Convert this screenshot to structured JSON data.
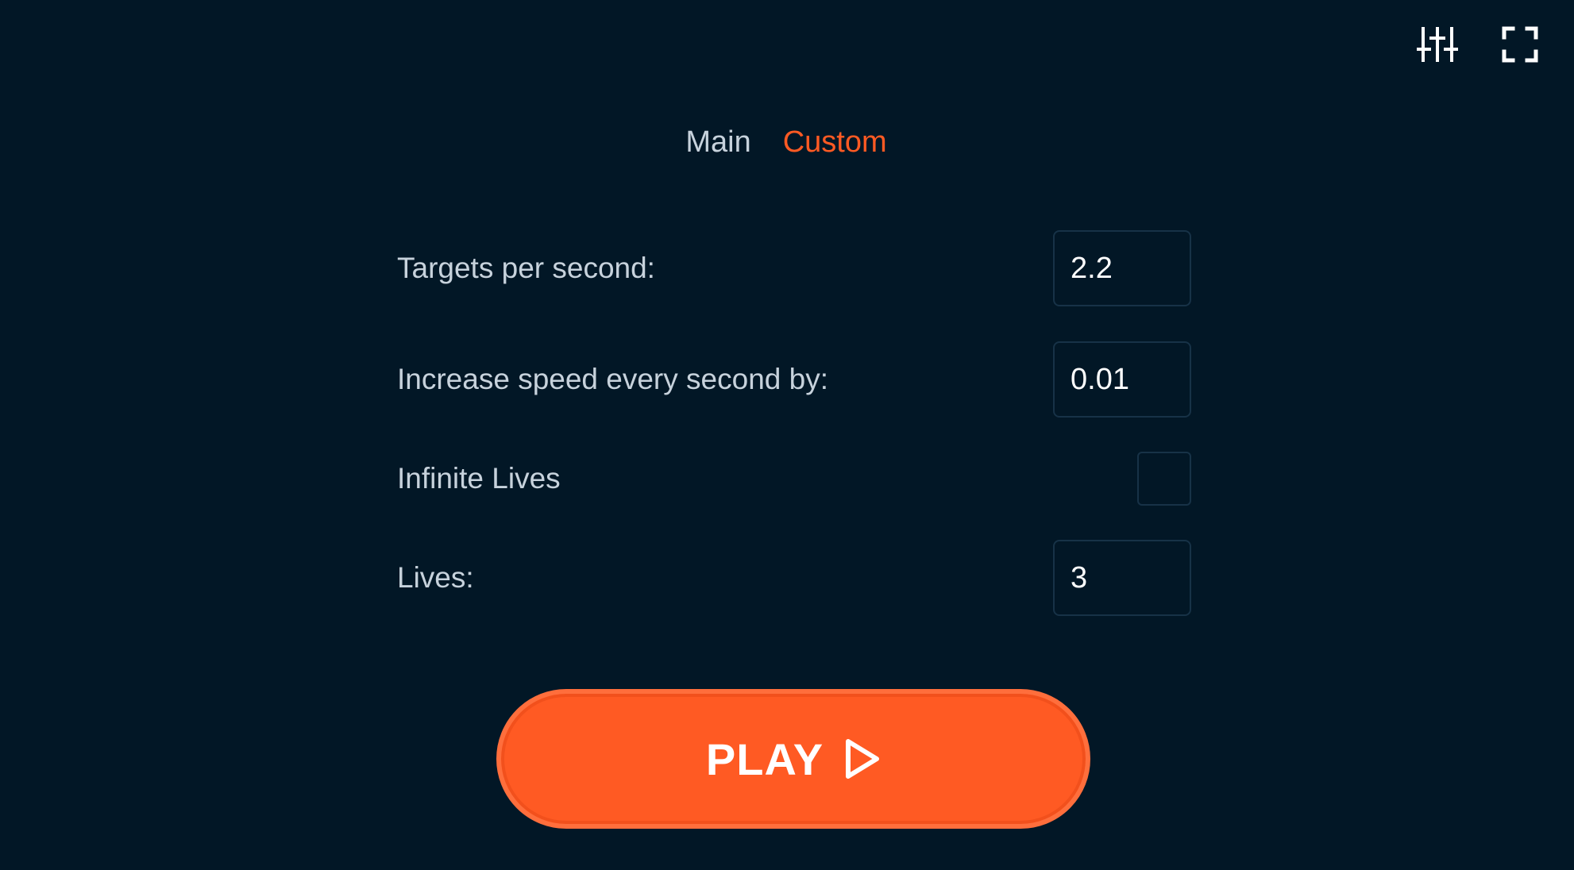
{
  "toolbar": {
    "settings_icon": "sliders-icon",
    "fullscreen_icon": "fullscreen-icon"
  },
  "tabs": [
    {
      "label": "Main",
      "active": false
    },
    {
      "label": "Custom",
      "active": true
    }
  ],
  "settings": {
    "targets_per_second": {
      "label": "Targets per second:",
      "value": "2.2"
    },
    "speed_increase": {
      "label": "Increase speed every second by:",
      "value": "0.01"
    },
    "infinite_lives": {
      "label": "Infinite Lives",
      "checked": false
    },
    "lives": {
      "label": "Lives:",
      "value": "3"
    }
  },
  "play": {
    "label": "PLAY",
    "icon": "play-icon"
  },
  "colors": {
    "background": "#021726",
    "accent": "#ff5a23",
    "text": "#c7d2dc",
    "input_border": "#173247"
  }
}
